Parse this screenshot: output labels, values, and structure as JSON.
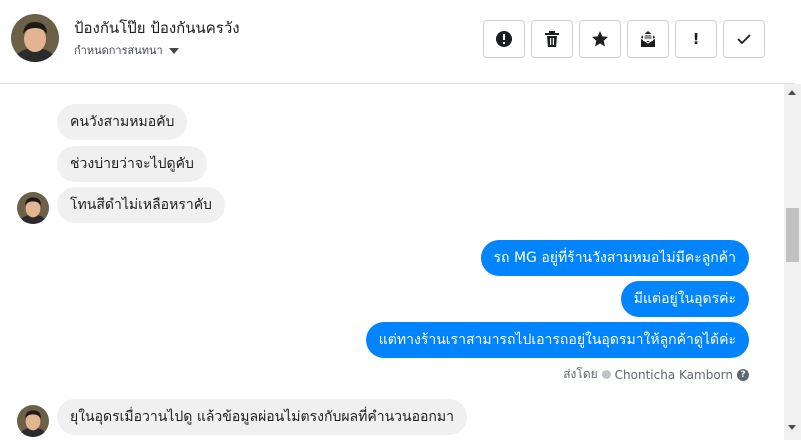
{
  "header": {
    "contact_name": "ป้องกันโป๊ย ป้องกันนครวัง",
    "subtitle": "กำหนดการสนทนา"
  },
  "toolbar": {
    "buttons": [
      {
        "name": "report-button",
        "icon": "exclamation-circle-icon"
      },
      {
        "name": "delete-button",
        "icon": "trash-icon"
      },
      {
        "name": "star-button",
        "icon": "star-icon"
      },
      {
        "name": "archive-button",
        "icon": "archive-envelope-icon"
      },
      {
        "name": "mark-important-button",
        "icon": "exclamation-icon",
        "glyph": "!"
      },
      {
        "name": "mark-done-button",
        "icon": "check-icon"
      }
    ]
  },
  "messages": [
    {
      "side": "in",
      "text": "คนวังสามหมอคับ"
    },
    {
      "side": "in",
      "text": "ช่วงบ่ายว่าจะไปดูคับ"
    },
    {
      "side": "in",
      "text": "โทนสีดำไม่เหลือหราคับ"
    },
    {
      "side": "out",
      "text": "รถ MG อยู่ที่ร้านวังสามหมอไม่มีคะลูกค้า"
    },
    {
      "side": "out",
      "text": "มีแต่อยู่ในอุดรค่ะ"
    },
    {
      "side": "out",
      "text": "แต่ทางร้านเราสามารถไปเอารถอยู่ในอุดรมาให้ลูกค้าดูได้ค่ะ"
    },
    {
      "side": "in",
      "text": "ยุในอุดรเมื่อวานไปดู แล้วข้อมูลผ่อนไม่ตรงกับผลที่คำนวนออกมา"
    }
  ],
  "sent_by": {
    "prefix": "ส่งโดย",
    "name": "Chonticha Kamborn",
    "help": "?"
  },
  "colors": {
    "outgoing_bubble": "#0084ff",
    "incoming_bubble": "#f1f0f0"
  }
}
